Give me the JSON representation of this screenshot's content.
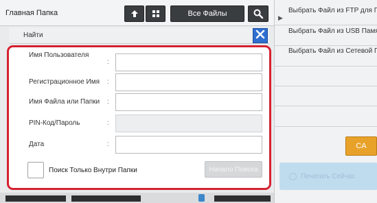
{
  "header": {
    "title": "Главная Папка",
    "all_files_label": "Все Файлы"
  },
  "dialog": {
    "title": "Найти",
    "fields": [
      {
        "label": "Имя Пользователя",
        "colon": ":",
        "value": "",
        "disabled": false
      },
      {
        "label": "Регистрационное Имя",
        "colon": ":",
        "value": "",
        "disabled": false
      },
      {
        "label": "Имя Файла или Папки",
        "colon": ":",
        "value": "",
        "disabled": false
      },
      {
        "label": "PIN-Код/Пароль",
        "colon": ":",
        "value": "",
        "disabled": true
      },
      {
        "label": "Дата",
        "colon": ":",
        "value": "",
        "disabled": false
      }
    ],
    "checkbox_label": "Поиск Только Внутри Папки",
    "checkbox_checked": false,
    "search_button_label": "Начало Поиска"
  },
  "sidebar": {
    "items": [
      {
        "label": "Выбрать Файл из FTP для Печати"
      },
      {
        "label": "Выбрать Файл из USB Памяти для Печати"
      },
      {
        "label": "Выбрать Файл из Сетевой Папки для Печати"
      }
    ],
    "ca_label": "CA",
    "start_label": "Печатать Сейчас"
  },
  "colors": {
    "accent_red": "#d6212f",
    "close_blue": "#2f6fd0",
    "ca_orange": "#e8a22a"
  }
}
